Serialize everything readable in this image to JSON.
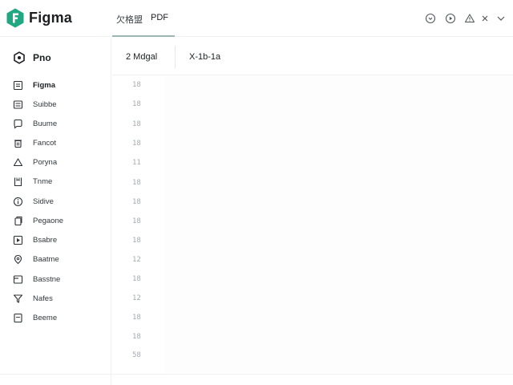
{
  "app": {
    "name": "Figma"
  },
  "colors": {
    "accent": "#1fa882",
    "accent_dark": "#0e7f63"
  },
  "tabs": [
    {
      "label": "欠格盟"
    },
    {
      "label": "PDF"
    }
  ],
  "toolbar_icons": [
    "refresh-icon",
    "play-circle-icon",
    "warning-icon",
    "close-icon",
    "chevron-down-icon"
  ],
  "sidebar": {
    "header": {
      "label": "Pno",
      "icon": "hex-icon"
    },
    "items": [
      {
        "label": "Figma",
        "icon": "file-icon"
      },
      {
        "label": "Suibbe",
        "icon": "list-icon"
      },
      {
        "label": "Buume",
        "icon": "chat-icon"
      },
      {
        "label": "Fancot",
        "icon": "trash-icon"
      },
      {
        "label": "Poryna",
        "icon": "triangle-icon"
      },
      {
        "label": "Tnme",
        "icon": "bookmark-icon"
      },
      {
        "label": "Sidive",
        "icon": "info-icon"
      },
      {
        "label": "Pegaone",
        "icon": "pages-icon"
      },
      {
        "label": "Bsabre",
        "icon": "play-box-icon"
      },
      {
        "label": "Baatme",
        "icon": "pin-icon"
      },
      {
        "label": "Basstne",
        "icon": "tray-icon"
      },
      {
        "label": "Nafes",
        "icon": "funnel-icon"
      },
      {
        "label": "Beeme",
        "icon": "doc-icon"
      }
    ]
  },
  "content": {
    "header_left": "2  Mdgal",
    "header_right": "X-1b-1a",
    "line_numbers": [
      "18",
      "18",
      "18",
      "18",
      "11",
      "18",
      "18",
      "18",
      "18",
      "12",
      "18",
      "12",
      "18",
      "18",
      "58"
    ]
  }
}
